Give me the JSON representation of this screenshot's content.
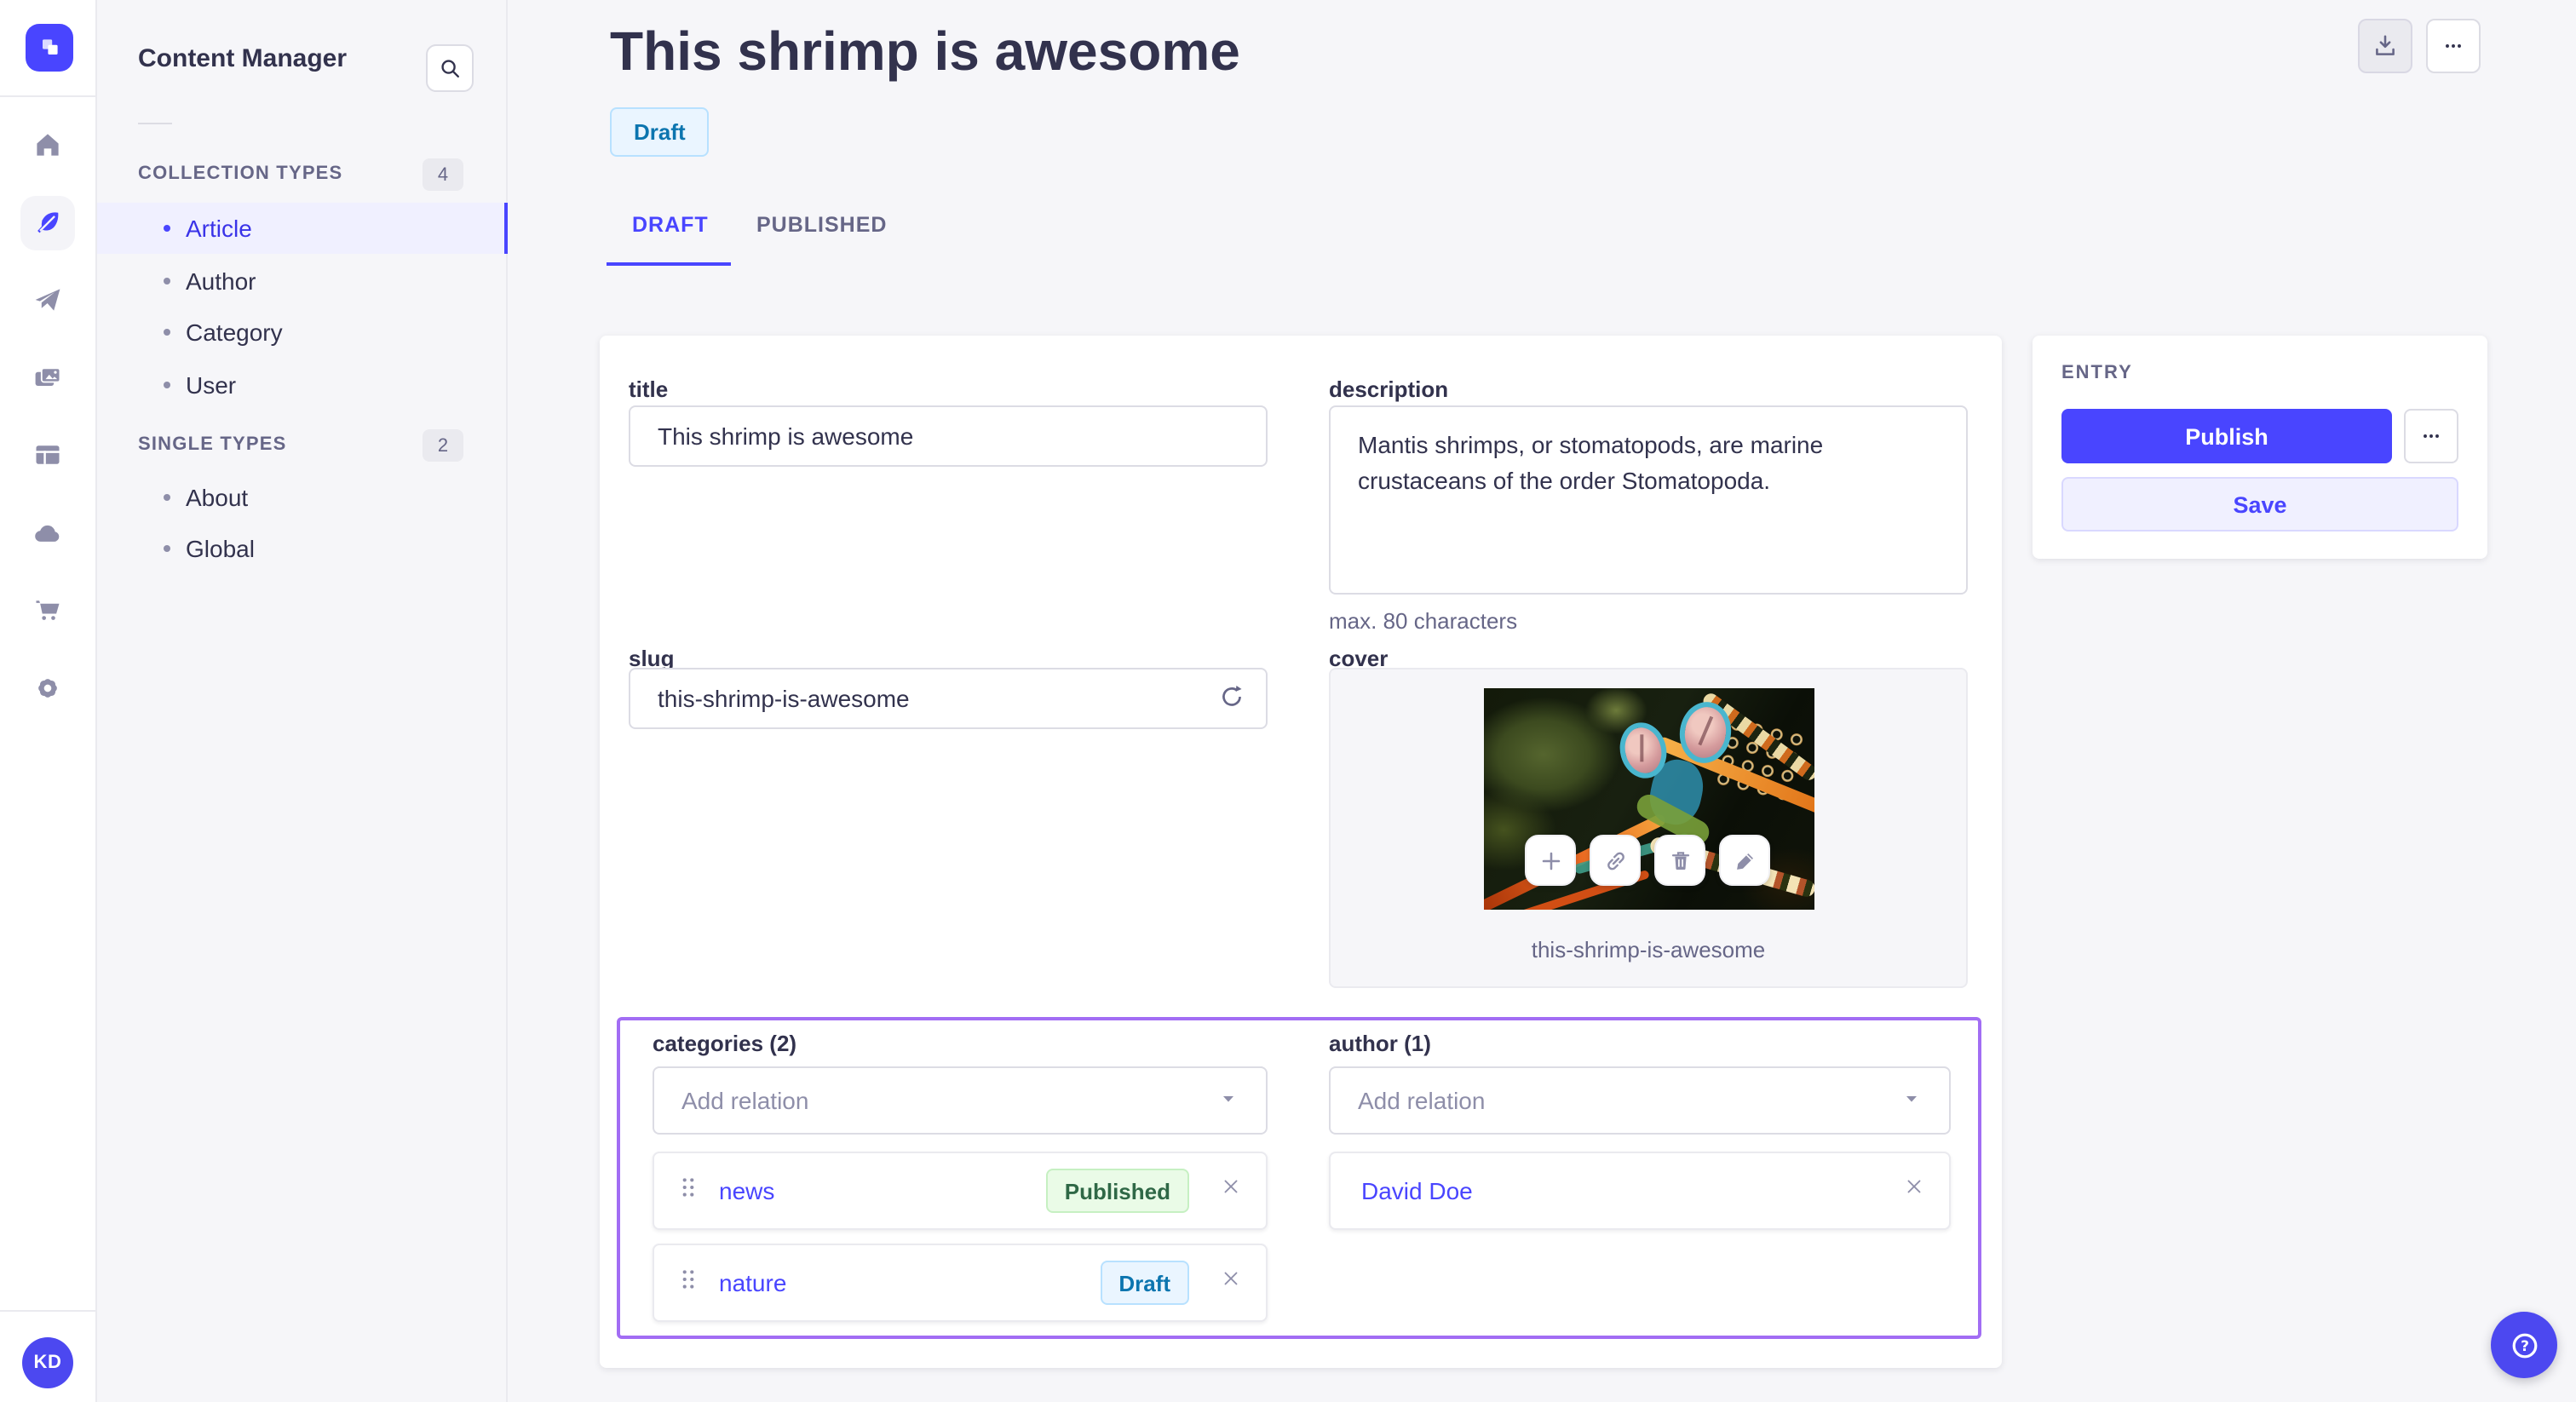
{
  "colors": {
    "accent": "#4945ff",
    "accent_light": "#f0f0ff",
    "highlight_border": "#a26df4",
    "success_text": "#2f6846",
    "draft_text": "#0c75af",
    "text_dark": "#32324d",
    "text_gray": "#666687"
  },
  "icon_rail": {
    "logo": "strapi-logo",
    "items": [
      {
        "icon": "home-icon"
      },
      {
        "icon": "feather-icon",
        "active": true
      },
      {
        "icon": "paper-plane-icon"
      },
      {
        "icon": "media-library-icon"
      },
      {
        "icon": "layout-icon"
      },
      {
        "icon": "cloud-icon"
      },
      {
        "icon": "cart-icon"
      },
      {
        "icon": "gear-icon"
      }
    ],
    "avatar_initials": "KD"
  },
  "subnav": {
    "title": "Content Manager",
    "sections": [
      {
        "label": "COLLECTION TYPES",
        "count": "4",
        "items": [
          {
            "label": "Article",
            "active": true
          },
          {
            "label": "Author"
          },
          {
            "label": "Category"
          },
          {
            "label": "User"
          }
        ]
      },
      {
        "label": "SINGLE TYPES",
        "count": "2",
        "items": [
          {
            "label": "About"
          },
          {
            "label": "Global"
          }
        ]
      }
    ]
  },
  "header": {
    "title": "This shrimp is awesome",
    "status": "Draft",
    "tabs": [
      {
        "label": "DRAFT",
        "active": true
      },
      {
        "label": "PUBLISHED"
      }
    ]
  },
  "form": {
    "title": {
      "label": "title",
      "value": "This shrimp is awesome"
    },
    "description": {
      "label": "description",
      "value": "Mantis shrimps, or stomatopods, are marine crustaceans of the order Stomatopoda.",
      "helper": "max. 80 characters"
    },
    "slug": {
      "label": "slug",
      "value": "this-shrimp-is-awesome"
    },
    "cover": {
      "label": "cover",
      "caption": "this-shrimp-is-awesome"
    },
    "categories": {
      "label": "categories (2)",
      "placeholder": "Add relation",
      "items": [
        {
          "name": "news",
          "status": "Published"
        },
        {
          "name": "nature",
          "status": "Draft"
        }
      ]
    },
    "author": {
      "label": "author (1)",
      "placeholder": "Add relation",
      "items": [
        {
          "name": "David Doe"
        }
      ]
    }
  },
  "entry_panel": {
    "heading": "ENTRY",
    "publish_label": "Publish",
    "save_label": "Save"
  }
}
